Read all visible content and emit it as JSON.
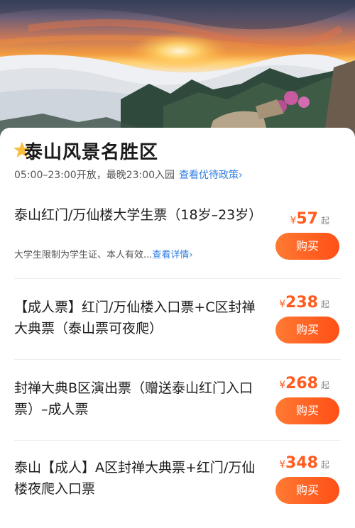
{
  "scenic": {
    "title": "泰山风景名胜区",
    "hours": "05:00–23:00开放，最晚23:00入园",
    "policy_link": "查看优待政策",
    "policy_arrow": "›"
  },
  "tickets": [
    {
      "name": "泰山红门/万仙楼大学生票（18岁–23岁）",
      "note": "大学生限制为学生证、本人有效...",
      "note_link": "查看详情",
      "note_arrow": "›",
      "currency": "¥",
      "price": "57",
      "price_suffix": "起",
      "button": "购买"
    },
    {
      "name": "【成人票】红门/万仙楼入口票+C区封禅大典票（泰山票可夜爬）",
      "currency": "¥",
      "price": "238",
      "price_suffix": "起",
      "button": "购买"
    },
    {
      "name": "封禅大典B区演出票（赠送泰山红门入口票）–成人票",
      "currency": "¥",
      "price": "268",
      "price_suffix": "起",
      "button": "购买"
    },
    {
      "name": "泰山【成人】A区封禅大典票+红门/万仙楼夜爬入口票",
      "currency": "¥",
      "price": "348",
      "price_suffix": "起",
      "button": "购买"
    }
  ],
  "colors": {
    "accent": "#ff5a1f",
    "link": "#2f7de1",
    "star": "#f5b82e"
  },
  "icons": {
    "title_decoration": "star-icon",
    "hero": "sunrise-sea-of-clouds-photo"
  }
}
